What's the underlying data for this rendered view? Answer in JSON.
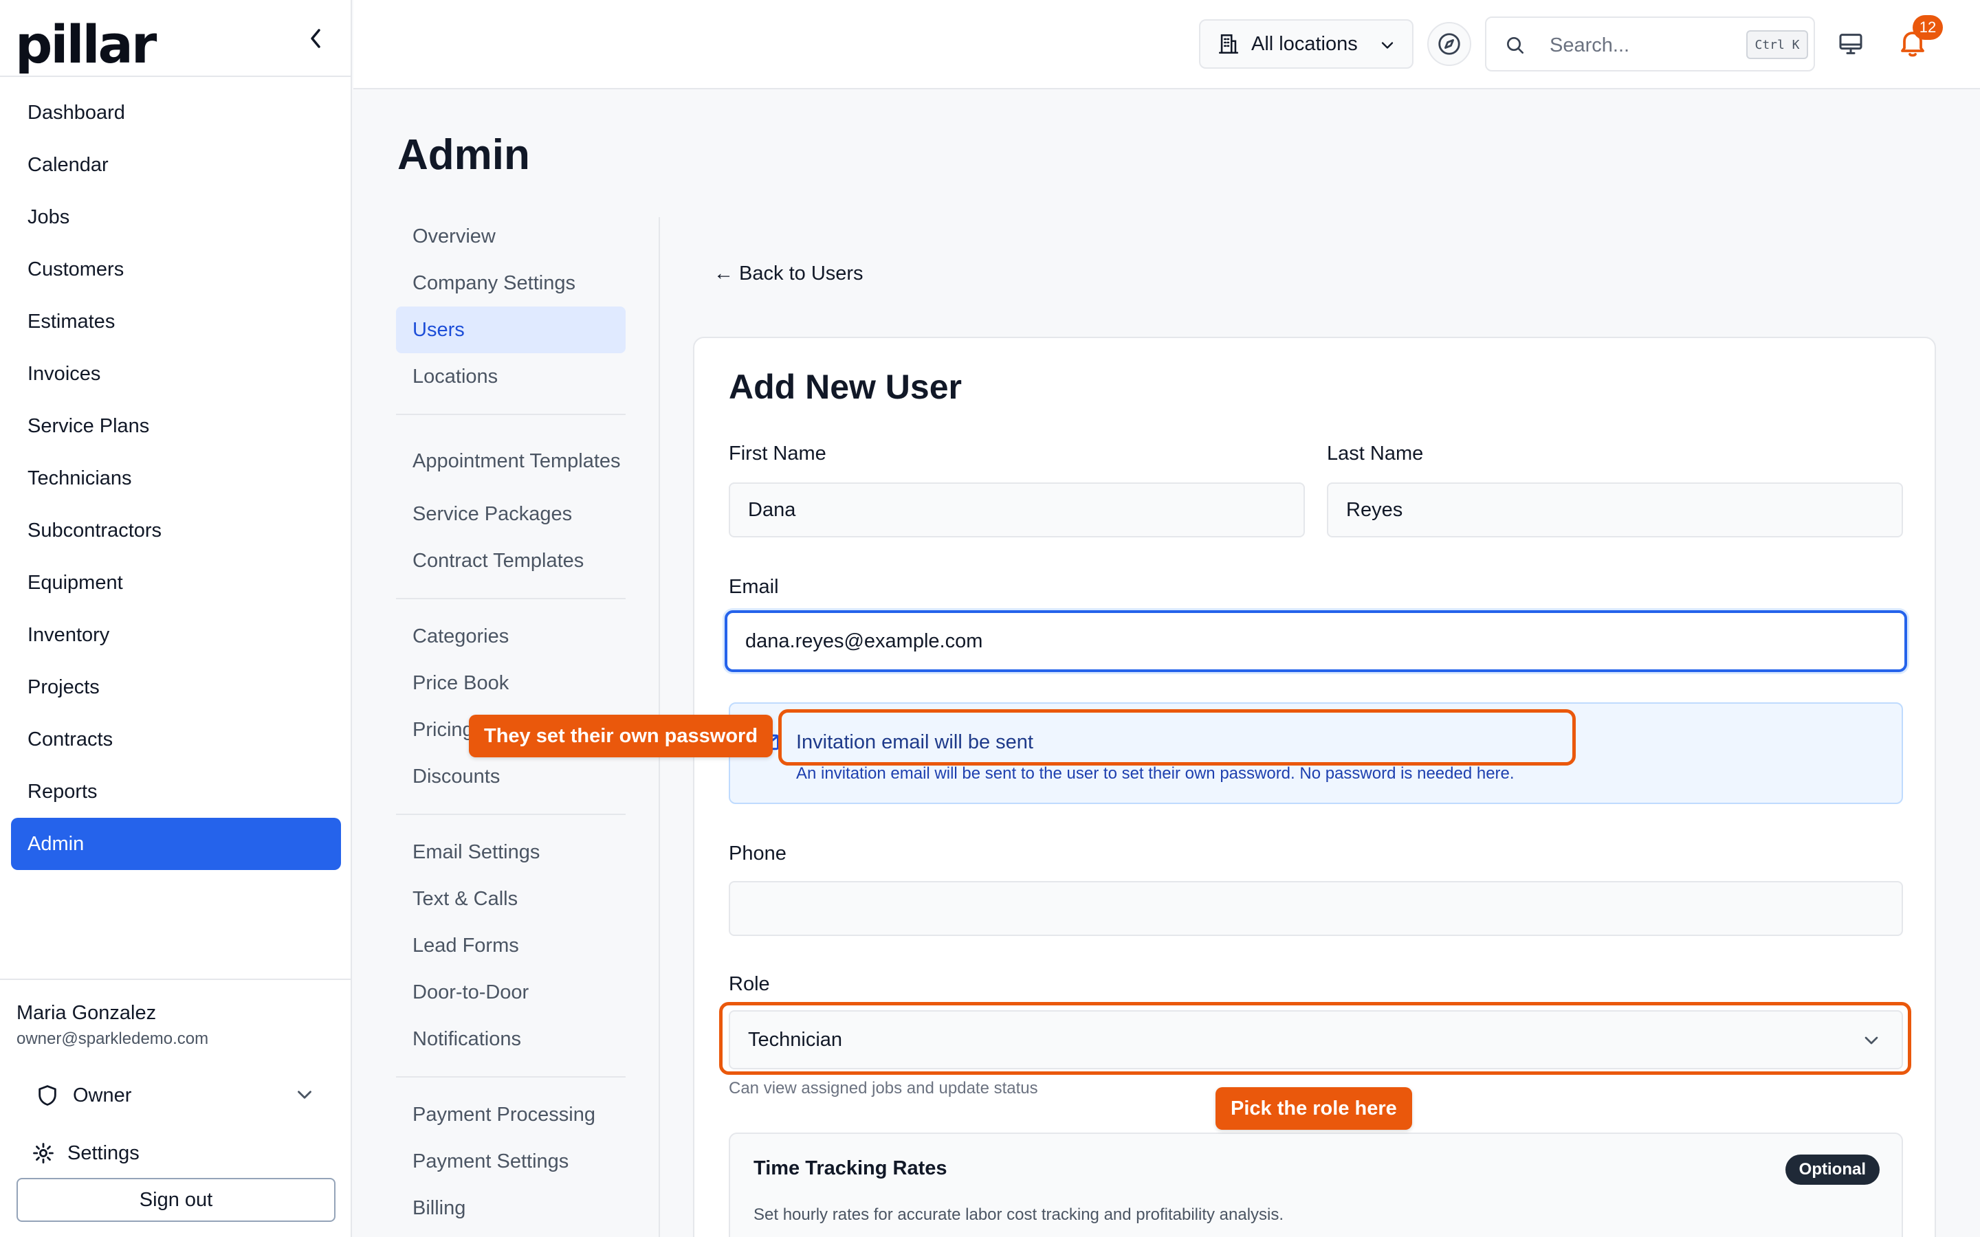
{
  "app": {
    "logo": "pillar"
  },
  "sidebar": {
    "items": [
      {
        "label": "Dashboard"
      },
      {
        "label": "Calendar"
      },
      {
        "label": "Jobs"
      },
      {
        "label": "Customers"
      },
      {
        "label": "Estimates"
      },
      {
        "label": "Invoices"
      },
      {
        "label": "Service Plans"
      },
      {
        "label": "Technicians"
      },
      {
        "label": "Subcontractors"
      },
      {
        "label": "Equipment"
      },
      {
        "label": "Inventory"
      },
      {
        "label": "Projects"
      },
      {
        "label": "Contracts"
      },
      {
        "label": "Reports"
      },
      {
        "label": "Admin"
      }
    ],
    "active": "Admin",
    "user": {
      "name": "Maria Gonzalez",
      "email": "owner@sparkledemo.com",
      "role": "Owner"
    },
    "settings_label": "Settings",
    "signout_label": "Sign out"
  },
  "topbar": {
    "location_label": "All locations",
    "search_placeholder": "Search...",
    "search_shortcut": "Ctrl K",
    "notifications_count": "12"
  },
  "main": {
    "title": "Admin",
    "subnav": {
      "group1": [
        "Overview",
        "Company Settings",
        "Users",
        "Locations"
      ],
      "group2": [
        "Appointment Templates",
        "Service Packages",
        "Contract Templates"
      ],
      "group3": [
        "Categories",
        "Price Book",
        "Pricing",
        "Discounts"
      ],
      "group4": [
        "Email Settings",
        "Text & Calls",
        "Lead Forms",
        "Door-to-Door",
        "Notifications"
      ],
      "group5": [
        "Payment Processing",
        "Payment Settings",
        "Billing"
      ],
      "active": "Users"
    },
    "back_link": "← Back to Users",
    "form": {
      "title": "Add New User",
      "first_name_label": "First Name",
      "first_name_value": "Dana",
      "last_name_label": "Last Name",
      "last_name_value": "Reyes",
      "email_label": "Email",
      "email_value": "dana.reyes@example.com",
      "info_title": "Invitation email will be sent",
      "info_text": "An invitation email will be sent to the user to set their own password. No password is needed here.",
      "phone_label": "Phone",
      "phone_value": "",
      "role_label": "Role",
      "role_value": "Technician",
      "role_helper": "Can view assigned jobs and update status",
      "time_tracking_title": "Time Tracking Rates",
      "time_tracking_badge": "Optional",
      "time_tracking_desc": "Set hourly rates for accurate labor cost tracking and profitability analysis."
    }
  },
  "annotations": {
    "password_tag": "They set their own password",
    "role_tag": "Pick the role here"
  },
  "colors": {
    "accent": "#2563eb",
    "annotation": "#ea580c"
  }
}
